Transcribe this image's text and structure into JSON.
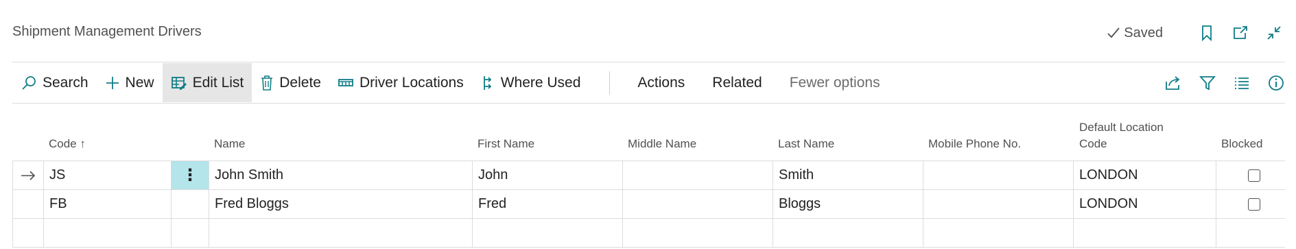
{
  "page": {
    "title": "Shipment Management Drivers",
    "saved_label": "Saved"
  },
  "header_icons": [
    "bookmark-icon",
    "open-new-window-icon",
    "collapse-icon"
  ],
  "actions": {
    "search": "Search",
    "new": "New",
    "edit_list": "Edit List",
    "delete": "Delete",
    "driver_locations": "Driver Locations",
    "where_used": "Where Used",
    "menu_actions": "Actions",
    "menu_related": "Related",
    "fewer_options": "Fewer options"
  },
  "right_icons": [
    "share-icon",
    "filter-icon",
    "list-view-icon",
    "info-icon"
  ],
  "columns": {
    "code": "Code",
    "name": "Name",
    "first_name": "First Name",
    "middle_name": "Middle Name",
    "last_name": "Last Name",
    "mobile_phone": "Mobile Phone No.",
    "default_location_line1": "Default Location",
    "default_location_line2": "Code",
    "blocked": "Blocked"
  },
  "sort_indicator": "↑",
  "rows": [
    {
      "code": "JS",
      "name": "John Smith",
      "first_name": "John",
      "middle_name": "",
      "last_name": "Smith",
      "mobile_phone": "",
      "default_location": "LONDON",
      "blocked": false,
      "selected": true
    },
    {
      "code": "FB",
      "name": "Fred Bloggs",
      "first_name": "Fred",
      "middle_name": "",
      "last_name": "Bloggs",
      "mobile_phone": "",
      "default_location": "LONDON",
      "blocked": false,
      "selected": false
    }
  ],
  "row_menu_glyph": "⋮",
  "colors": {
    "accent": "#0e7c86",
    "selected_row_menu": "#b3e5ea"
  }
}
